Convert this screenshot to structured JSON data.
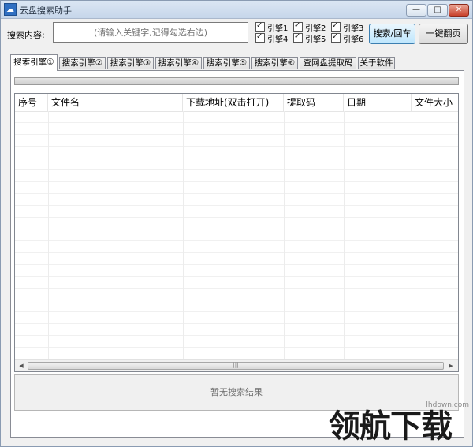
{
  "window": {
    "title": "云盘搜索助手",
    "app_icon": "cloud-search-app-icon",
    "controls": {
      "minimize": "—",
      "maximize": "□",
      "close": "✕"
    }
  },
  "search": {
    "label": "搜索内容:",
    "placeholder": "(请输入关键字,记得勾选右边)",
    "value": ""
  },
  "engines": [
    {
      "label": "引擎1",
      "checked": true
    },
    {
      "label": "引擎2",
      "checked": true
    },
    {
      "label": "引擎3",
      "checked": true
    },
    {
      "label": "引擎4",
      "checked": true
    },
    {
      "label": "引擎5",
      "checked": true
    },
    {
      "label": "引擎6",
      "checked": true
    }
  ],
  "buttons": {
    "search": "搜索/回车",
    "page": "一键翻页"
  },
  "tabs": [
    "搜索引擎①",
    "搜索引擎②",
    "搜索引擎③",
    "搜索引擎④",
    "搜索引擎⑤",
    "搜索引擎⑥",
    "查网盘提取码",
    "关于软件"
  ],
  "active_tab": 0,
  "table": {
    "columns": [
      "序号",
      "文件名",
      "下载地址(双击打开)",
      "提取码",
      "日期",
      "文件大小"
    ],
    "rows": []
  },
  "scrollbar": {
    "left_arrow": "◀",
    "right_arrow": "▶",
    "grip": "|||"
  },
  "result": {
    "status": "暂无搜索结果"
  },
  "watermark": {
    "url": "lhdown.com",
    "logo": "领航下载"
  },
  "colors": {
    "accent": "#3c7fb1",
    "title_bar": "#c6d6ea",
    "close": "#c9412c"
  }
}
